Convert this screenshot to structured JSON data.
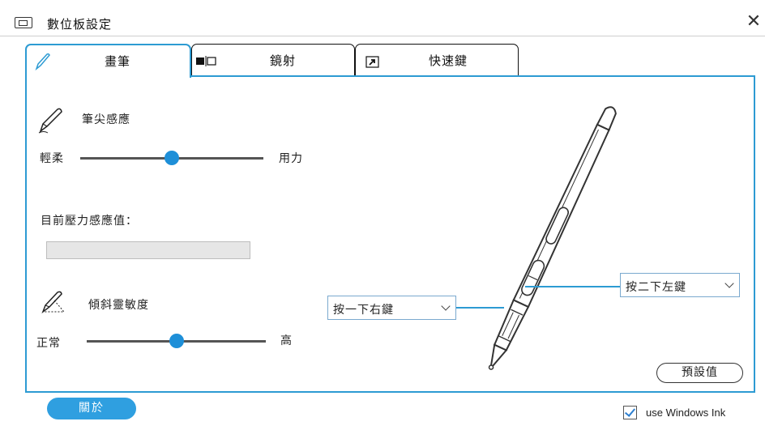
{
  "window": {
    "title": "數位板設定",
    "close_icon": "close-icon"
  },
  "tabs": [
    {
      "label": "畫筆",
      "icon": "pen-icon",
      "active": true
    },
    {
      "label": "鏡射",
      "icon": "mirror-icon",
      "active": false
    },
    {
      "label": "快速鍵",
      "icon": "shortcut-icon",
      "active": false
    }
  ],
  "pen_pressure": {
    "title": "筆尖感應",
    "left_label": "輕柔",
    "right_label": "用力",
    "slider_value": 0.5
  },
  "current_pressure": {
    "label": "目前壓力感應值：",
    "value": 0
  },
  "tilt": {
    "title": "傾斜靈敏度",
    "left_label": "正常",
    "right_label": "高",
    "slider_value": 0.5
  },
  "pen_buttons": {
    "lower": {
      "selected": "按一下右鍵"
    },
    "upper": {
      "selected": "按二下左鍵"
    }
  },
  "buttons": {
    "default": "預設值",
    "about": "關於"
  },
  "windows_ink": {
    "label": "use Windows Ink",
    "checked": true
  },
  "colors": {
    "accent": "#2d9bd3",
    "slider_thumb": "#1e8fd8",
    "about_button": "#2f9fe0"
  }
}
